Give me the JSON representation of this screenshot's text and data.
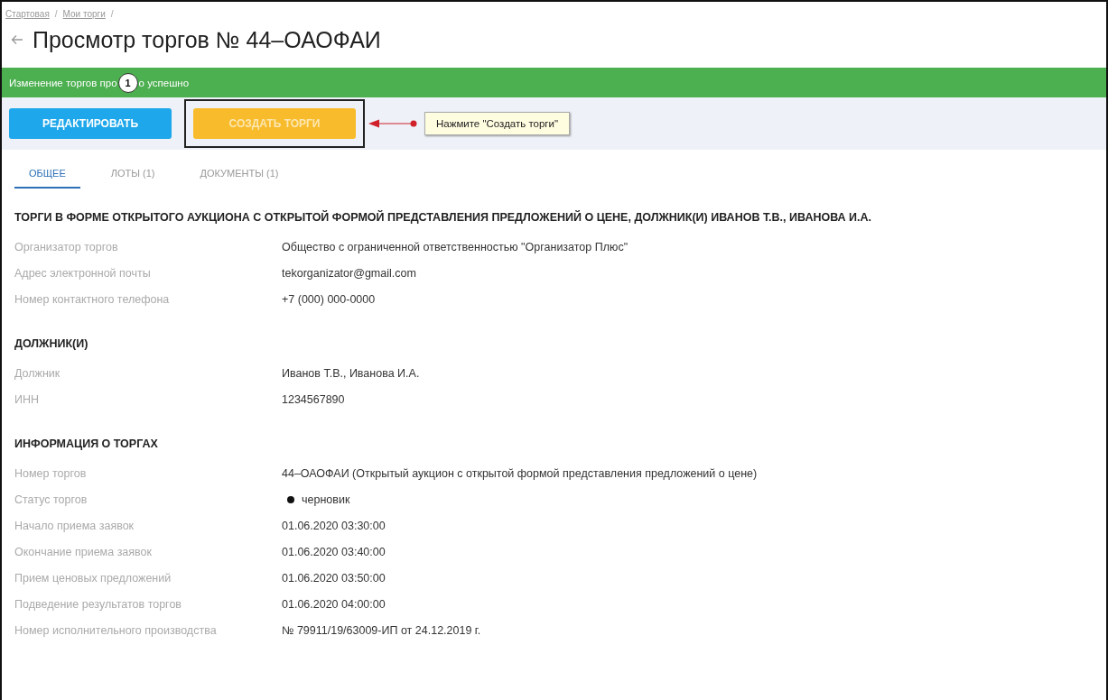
{
  "breadcrumbs": [
    {
      "label": "Стартовая",
      "separator": "/"
    },
    {
      "label": "Мои торги",
      "separator": "/"
    }
  ],
  "title": "Просмотр торгов № 44–ОАОФАИ",
  "banner": {
    "text_before": "Изменение торгов про",
    "marker": "1",
    "text_after": "о успешно"
  },
  "actions": [
    {
      "label": "РЕДАКТИРОВАТЬ",
      "kind": "edit",
      "highlighted": false
    },
    {
      "label": "СОЗДАТЬ ТОРГИ",
      "kind": "create",
      "highlighted": true
    }
  ],
  "callout": {
    "text": "Нажмите \"Создать торги\""
  },
  "tabs": [
    {
      "label": "ОБЩЕЕ",
      "selected": true
    },
    {
      "label": "ЛОТЫ (1)",
      "selected": false
    },
    {
      "label": "ДОКУМЕНТЫ (1)",
      "selected": false
    }
  ],
  "sections": [
    {
      "heading": "ТОРГИ В ФОРМЕ ОТКРЫТОГО АУКЦИОНА С ОТКРЫТОЙ ФОРМОЙ ПРЕДСТАВЛЕНИЯ ПРЕДЛОЖЕНИЙ О ЦЕНЕ, ДОЛЖНИК(И) ИВАНОВ Т.В., ИВАНОВА И.А.",
      "rows": [
        {
          "label": "Организатор торгов",
          "value": "Общество с ограниченной ответственностью \"Организатор Плюс\"",
          "kind": "text"
        },
        {
          "label": "Адрес электронной почты",
          "value": "tekorganizator@gmail.com",
          "kind": "text"
        },
        {
          "label": "Номер контактного телефона",
          "value": "+7 (000) 000-0000",
          "kind": "text"
        }
      ]
    },
    {
      "heading": "ДОЛЖНИК(И)",
      "rows": [
        {
          "label": "Должник",
          "value": "Иванов Т.В., Иванова И.А.",
          "kind": "text"
        },
        {
          "label": "ИНН",
          "value": "1234567890",
          "kind": "text"
        }
      ]
    },
    {
      "heading": "ИНФОРМАЦИЯ О ТОРГАХ",
      "rows": [
        {
          "label": "Номер торгов",
          "value": "44–ОАОФАИ (Открытый аукцион с открытой формой представления предложений о цене)",
          "kind": "text"
        },
        {
          "label": "Статус торгов",
          "value": "черновик",
          "kind": "status",
          "color": "#111111"
        },
        {
          "label": "Начало приема заявок",
          "value": "01.06.2020 03:30:00",
          "kind": "text"
        },
        {
          "label": "Окончание приема заявок",
          "value": "01.06.2020 03:40:00",
          "kind": "text"
        },
        {
          "label": "Прием ценовых предложений",
          "value": "01.06.2020 03:50:00",
          "kind": "text"
        },
        {
          "label": "Подведение результатов торгов",
          "value": "01.06.2020 04:00:00",
          "kind": "text"
        },
        {
          "label": "Номер исполнительного производства",
          "value": "№ 79911/19/63009-ИП от 24.12.2019 г.",
          "kind": "text"
        }
      ]
    }
  ]
}
